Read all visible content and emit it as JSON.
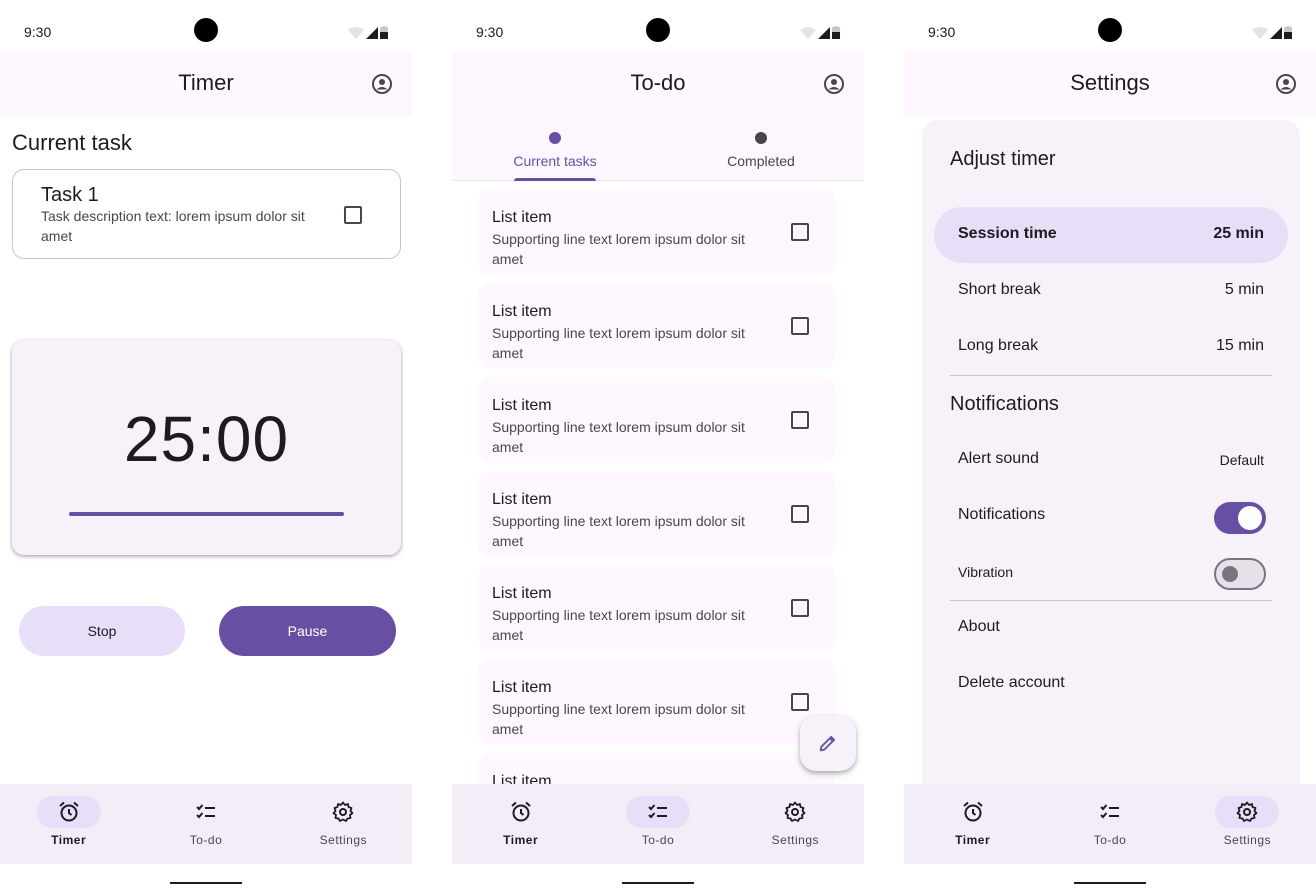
{
  "colors": {
    "primary": "#6750a4",
    "secondary_container": "#e8def8",
    "surface": "#fef7ff",
    "surface_container": "#f3edf7"
  },
  "status_bar": {
    "time": "9:30"
  },
  "nav": {
    "timer": "Timer",
    "todo": "To-do",
    "settings": "Settings"
  },
  "timer_screen": {
    "title": "Timer",
    "section_title": "Current task",
    "task": {
      "title": "Task 1",
      "description": "Task description text: lorem ipsum dolor sit amet"
    },
    "countdown": "25:00",
    "progress": 1.0,
    "stop_label": "Stop",
    "pause_label": "Pause"
  },
  "todo_screen": {
    "title": "To-do",
    "tabs": [
      {
        "label": "Current tasks",
        "selected": true
      },
      {
        "label": "Completed",
        "selected": false
      }
    ],
    "items": [
      {
        "title": "List item",
        "supporting": "Supporting line text lorem ipsum dolor sit amet"
      },
      {
        "title": "List item",
        "supporting": "Supporting line text lorem ipsum dolor sit amet"
      },
      {
        "title": "List item",
        "supporting": "Supporting line text lorem ipsum dolor sit amet"
      },
      {
        "title": "List item",
        "supporting": "Supporting line text lorem ipsum dolor sit amet"
      },
      {
        "title": "List item",
        "supporting": "Supporting line text lorem ipsum dolor sit amet"
      },
      {
        "title": "List item",
        "supporting": "Supporting line text lorem ipsum dolor sit amet"
      },
      {
        "title": "List item",
        "supporting": ""
      }
    ]
  },
  "settings_screen": {
    "title": "Settings",
    "adjust_timer": {
      "heading": "Adjust timer",
      "session": {
        "label": "Session time",
        "value": "25 min"
      },
      "short_break": {
        "label": "Short break",
        "value": "5 min"
      },
      "long_break": {
        "label": "Long break",
        "value": "15 min"
      }
    },
    "notifications": {
      "heading": "Notifications",
      "alert_sound": {
        "label": "Alert sound",
        "value": "Default"
      },
      "notifications_toggle": {
        "label": "Notifications",
        "on": true
      },
      "vibration_toggle": {
        "label": "Vibration",
        "on": false
      }
    },
    "about_label": "About",
    "delete_label": "Delete account"
  }
}
